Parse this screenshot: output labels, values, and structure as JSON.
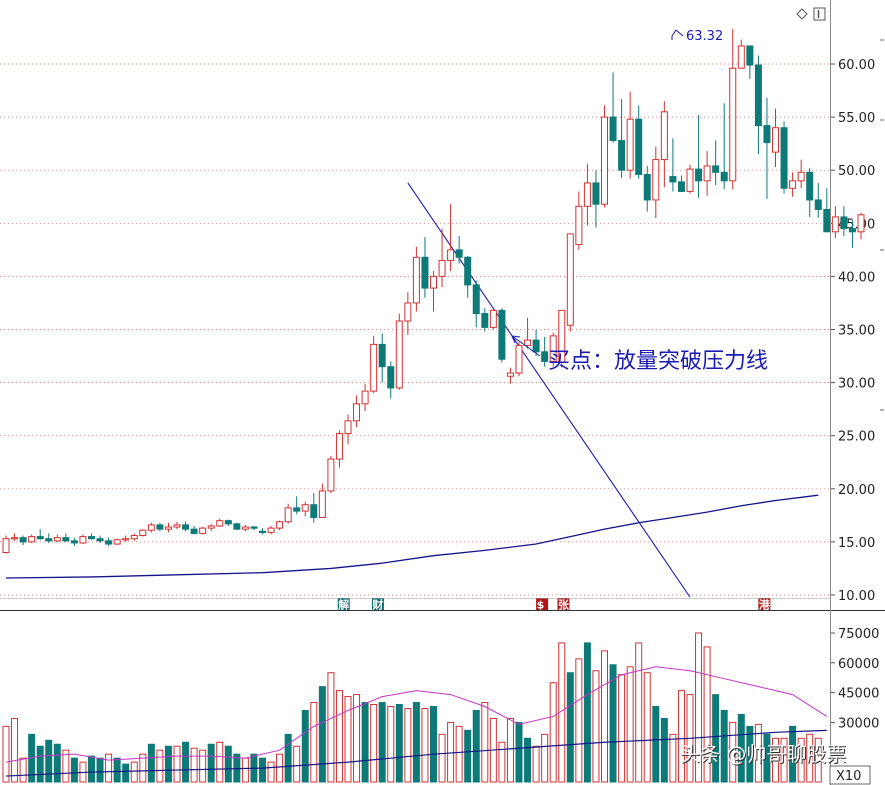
{
  "chart_data": [
    {
      "type": "candlestick",
      "title": "",
      "y_axis_side": "right",
      "ylim": [
        9,
        66
      ],
      "yticks": [
        "10.00",
        "15.00",
        "20.00",
        "25.00",
        "30.00",
        "35.00",
        "40.00",
        "45.00",
        "50.00",
        "55.00",
        "60.00"
      ],
      "grid": true,
      "colors": {
        "up": "#d23232",
        "down": "#0d7a78",
        "ma": "#14148c",
        "trendline": "#1a1ab4",
        "grid": "#c86464"
      },
      "peak_label": "63.32",
      "peak_value": 63.32,
      "annotation": {
        "text": "买点：放量突破压力线",
        "pointer_target_index": 61
      },
      "trendline": {
        "from_index": 47,
        "from_price": 48.8,
        "to_index": 80,
        "to_price": 9.8
      },
      "ma_line": [
        [
          0,
          11.6
        ],
        [
          10,
          11.7
        ],
        [
          20,
          11.9
        ],
        [
          30,
          12.1
        ],
        [
          38,
          12.5
        ],
        [
          44,
          13.0
        ],
        [
          50,
          13.7
        ],
        [
          56,
          14.2
        ],
        [
          62,
          14.8
        ],
        [
          66,
          15.5
        ],
        [
          70,
          16.2
        ],
        [
          74,
          16.8
        ],
        [
          78,
          17.3
        ],
        [
          82,
          17.8
        ],
        [
          86,
          18.4
        ],
        [
          90,
          18.9
        ],
        [
          95,
          19.4
        ]
      ],
      "event_badges": [
        {
          "index": 39.5,
          "label": "解",
          "color": "#0d6e6e"
        },
        {
          "index": 43.5,
          "label": "财",
          "color": "#0d6e6e"
        },
        {
          "index": 62.7,
          "label": "$",
          "color": "#b01818"
        },
        {
          "index": 65.2,
          "label": "张",
          "color": "#b01818"
        },
        {
          "index": 88.7,
          "label": "港",
          "color": "#b01818"
        }
      ],
      "candles": [
        [
          14.0,
          15.6,
          13.9,
          15.3
        ],
        [
          15.3,
          15.8,
          15.1,
          15.4
        ],
        [
          15.4,
          15.6,
          14.7,
          15.0
        ],
        [
          15.0,
          15.7,
          14.9,
          15.5
        ],
        [
          15.5,
          16.2,
          15.2,
          15.3
        ],
        [
          15.3,
          15.8,
          14.9,
          15.1
        ],
        [
          15.1,
          15.7,
          15.0,
          15.4
        ],
        [
          15.4,
          15.8,
          15.0,
          15.1
        ],
        [
          15.1,
          15.4,
          14.6,
          14.9
        ],
        [
          14.9,
          15.7,
          14.8,
          15.5
        ],
        [
          15.5,
          15.8,
          15.2,
          15.3
        ],
        [
          15.3,
          15.6,
          14.9,
          15.1
        ],
        [
          15.1,
          15.4,
          14.6,
          14.8
        ],
        [
          14.8,
          15.3,
          14.7,
          15.2
        ],
        [
          15.2,
          15.6,
          15.0,
          15.3
        ],
        [
          15.3,
          15.8,
          15.1,
          15.6
        ],
        [
          15.6,
          16.2,
          15.5,
          16.1
        ],
        [
          16.1,
          16.8,
          15.9,
          16.6
        ],
        [
          16.6,
          16.8,
          16.0,
          16.2
        ],
        [
          16.2,
          16.8,
          15.9,
          16.4
        ],
        [
          16.4,
          16.9,
          16.2,
          16.6
        ],
        [
          16.6,
          16.9,
          16.0,
          16.2
        ],
        [
          16.2,
          16.5,
          15.7,
          15.8
        ],
        [
          15.8,
          16.4,
          15.7,
          16.3
        ],
        [
          16.3,
          16.7,
          16.0,
          16.5
        ],
        [
          16.5,
          17.2,
          16.4,
          17.0
        ],
        [
          17.0,
          17.1,
          16.5,
          16.7
        ],
        [
          16.7,
          16.8,
          16.1,
          16.2
        ],
        [
          16.2,
          16.6,
          16.0,
          16.4
        ],
        [
          16.4,
          16.5,
          16.1,
          16.3
        ],
        [
          16.0,
          16.3,
          15.7,
          15.9
        ],
        [
          15.9,
          16.5,
          15.7,
          16.3
        ],
        [
          16.3,
          17.0,
          16.1,
          16.9
        ],
        [
          16.9,
          18.6,
          16.7,
          18.2
        ],
        [
          18.2,
          19.3,
          17.6,
          17.9
        ],
        [
          17.9,
          18.8,
          17.4,
          18.5
        ],
        [
          18.5,
          19.6,
          16.8,
          17.3
        ],
        [
          17.3,
          20.5,
          17.3,
          19.8
        ],
        [
          19.8,
          23.1,
          19.6,
          22.8
        ],
        [
          22.8,
          25.5,
          22.0,
          25.2
        ],
        [
          25.2,
          27.0,
          24.2,
          26.4
        ],
        [
          26.4,
          28.8,
          25.8,
          28.0
        ],
        [
          28.0,
          29.9,
          27.3,
          29.2
        ],
        [
          29.2,
          34.4,
          29.0,
          33.6
        ],
        [
          33.6,
          34.6,
          30.0,
          31.5
        ],
        [
          31.5,
          32.0,
          28.5,
          29.5
        ],
        [
          29.5,
          36.5,
          29.3,
          35.8
        ],
        [
          35.8,
          38.5,
          34.5,
          37.5
        ],
        [
          37.5,
          42.8,
          36.7,
          41.8
        ],
        [
          41.8,
          43.7,
          38.0,
          38.9
        ],
        [
          38.9,
          40.5,
          36.7,
          40.0
        ],
        [
          40.0,
          44.5,
          39.0,
          41.5
        ],
        [
          41.5,
          46.8,
          40.5,
          42.5
        ],
        [
          42.5,
          43.8,
          41.2,
          41.8
        ],
        [
          41.8,
          41.9,
          38.0,
          39.2
        ],
        [
          39.2,
          39.6,
          35.2,
          36.5
        ],
        [
          36.5,
          37.0,
          34.8,
          35.2
        ],
        [
          35.2,
          37.1,
          35.0,
          36.8
        ],
        [
          36.8,
          37.0,
          31.9,
          32.2
        ],
        [
          30.6,
          31.4,
          29.9,
          30.9
        ],
        [
          30.9,
          33.8,
          30.6,
          33.5
        ],
        [
          33.5,
          36.1,
          33.2,
          34.0
        ],
        [
          34.0,
          35.0,
          32.5,
          32.9
        ],
        [
          32.9,
          34.3,
          31.5,
          32.0
        ],
        [
          32.0,
          34.7,
          31.5,
          34.4
        ],
        [
          31.9,
          32.4,
          31.4,
          36.8
        ],
        [
          35.4,
          37.6,
          34.8,
          44.0
        ],
        [
          43.0,
          48.0,
          42.5,
          46.6
        ],
        [
          46.6,
          50.6,
          44.8,
          48.8
        ],
        [
          48.8,
          50.0,
          44.6,
          46.8
        ],
        [
          46.8,
          56.1,
          46.5,
          55.0
        ],
        [
          55.0,
          59.2,
          52.6,
          52.8
        ],
        [
          52.8,
          56.7,
          49.3,
          50.0
        ],
        [
          50.0,
          57.4,
          49.2,
          54.8
        ],
        [
          54.8,
          56.1,
          49.2,
          49.6
        ],
        [
          49.6,
          50.4,
          46.1,
          47.2
        ],
        [
          47.2,
          52.2,
          45.5,
          51.0
        ],
        [
          51.0,
          56.5,
          48.4,
          55.5
        ],
        [
          49.4,
          53.0,
          48.0,
          48.9
        ],
        [
          48.9,
          49.5,
          48.0,
          48.0
        ],
        [
          48.0,
          50.5,
          47.8,
          50.1
        ],
        [
          50.1,
          55.2,
          47.4,
          49.0
        ],
        [
          49.0,
          51.8,
          47.6,
          50.4
        ],
        [
          50.4,
          52.8,
          48.6,
          49.8
        ],
        [
          49.8,
          56.3,
          48.2,
          49.0
        ],
        [
          49.0,
          63.32,
          48.2,
          59.6
        ],
        [
          59.6,
          62.3,
          59.6,
          61.7
        ],
        [
          61.7,
          60.8,
          58.6,
          59.9
        ],
        [
          59.9,
          60.8,
          51.5,
          54.2
        ],
        [
          54.2,
          56.8,
          47.3,
          52.6
        ],
        [
          51.7,
          55.8,
          50.3,
          54.0
        ],
        [
          54.0,
          54.6,
          47.8,
          48.3
        ],
        [
          48.3,
          49.8,
          47.5,
          49.0
        ],
        [
          49.0,
          51.0,
          48.3,
          49.8
        ],
        [
          49.8,
          50.2,
          45.6,
          47.2
        ],
        [
          47.2,
          48.8,
          45.5,
          46.3
        ],
        [
          46.3,
          48.3,
          44.7,
          44.2
        ],
        [
          44.2,
          46.6,
          43.6,
          45.6
        ],
        [
          45.6,
          46.6,
          43.8,
          44.5
        ],
        [
          44.5,
          45.3,
          42.7,
          44.2
        ],
        [
          44.2,
          46.0,
          43.5,
          45.8
        ]
      ]
    },
    {
      "type": "volume-bar",
      "ylim": [
        0,
        84000
      ],
      "yticks": [
        "30000",
        "45000",
        "60000",
        "75000"
      ],
      "unit_label": "X10",
      "ma_short": [
        [
          0,
          10
        ],
        [
          4,
          13
        ],
        [
          8,
          14
        ],
        [
          12,
          11
        ],
        [
          16,
          12
        ],
        [
          20,
          13
        ],
        [
          24,
          13
        ],
        [
          28,
          12
        ],
        [
          32,
          16
        ],
        [
          36,
          28
        ],
        [
          40,
          36
        ],
        [
          44,
          43
        ],
        [
          48,
          46
        ],
        [
          52,
          44
        ],
        [
          56,
          38
        ],
        [
          60,
          29
        ],
        [
          64,
          33
        ],
        [
          68,
          44
        ],
        [
          72,
          54
        ],
        [
          76,
          58
        ],
        [
          80,
          56
        ],
        [
          84,
          52
        ],
        [
          88,
          48
        ],
        [
          92,
          44
        ],
        [
          96,
          33
        ]
      ],
      "ma_long": [
        [
          0,
          3
        ],
        [
          10,
          5
        ],
        [
          20,
          6
        ],
        [
          30,
          7
        ],
        [
          40,
          10
        ],
        [
          50,
          14
        ],
        [
          60,
          17
        ],
        [
          70,
          20
        ],
        [
          80,
          22
        ],
        [
          90,
          25
        ],
        [
          96,
          26
        ]
      ],
      "bars": [
        [
          28,
          1
        ],
        [
          32,
          1
        ],
        [
          12,
          1
        ],
        [
          24,
          0
        ],
        [
          18,
          0
        ],
        [
          21,
          0
        ],
        [
          19,
          0
        ],
        [
          16,
          1
        ],
        [
          12,
          0
        ],
        [
          10,
          1
        ],
        [
          13,
          0
        ],
        [
          12,
          0
        ],
        [
          14,
          1
        ],
        [
          12,
          0
        ],
        [
          9,
          0
        ],
        [
          10,
          1
        ],
        [
          14,
          1
        ],
        [
          19,
          0
        ],
        [
          16,
          1
        ],
        [
          18,
          0
        ],
        [
          18,
          1
        ],
        [
          20,
          0
        ],
        [
          17,
          1
        ],
        [
          16,
          1
        ],
        [
          19,
          0
        ],
        [
          20,
          1
        ],
        [
          18,
          0
        ],
        [
          14,
          0
        ],
        [
          12,
          1
        ],
        [
          14,
          0
        ],
        [
          12,
          0
        ],
        [
          10,
          1
        ],
        [
          14,
          1
        ],
        [
          24,
          0
        ],
        [
          18,
          1
        ],
        [
          36,
          0
        ],
        [
          40,
          1
        ],
        [
          48,
          0
        ],
        [
          55,
          1
        ],
        [
          46,
          1
        ],
        [
          43,
          1
        ],
        [
          44,
          1
        ],
        [
          40,
          0
        ],
        [
          39,
          1
        ],
        [
          40,
          0
        ],
        [
          38,
          1
        ],
        [
          39,
          0
        ],
        [
          37,
          1
        ],
        [
          40,
          0
        ],
        [
          37,
          1
        ],
        [
          38,
          0
        ],
        [
          24,
          1
        ],
        [
          30,
          1
        ],
        [
          28,
          1
        ],
        [
          26,
          0
        ],
        [
          36,
          0
        ],
        [
          40,
          1
        ],
        [
          32,
          1
        ],
        [
          20,
          1
        ],
        [
          32,
          1
        ],
        [
          30,
          0
        ],
        [
          22,
          0
        ],
        [
          18,
          1
        ],
        [
          24,
          1
        ],
        [
          50,
          1
        ],
        [
          70,
          1
        ],
        [
          55,
          0
        ],
        [
          62,
          1
        ],
        [
          70,
          0
        ],
        [
          56,
          1
        ],
        [
          66,
          1
        ],
        [
          59,
          0
        ],
        [
          54,
          1
        ],
        [
          58,
          1
        ],
        [
          70,
          1
        ],
        [
          55,
          1
        ],
        [
          38,
          0
        ],
        [
          32,
          0
        ],
        [
          24,
          1
        ],
        [
          46,
          1
        ],
        [
          44,
          1
        ],
        [
          75,
          1
        ],
        [
          68,
          1
        ],
        [
          44,
          0
        ],
        [
          36,
          0
        ],
        [
          30,
          1
        ],
        [
          34,
          0
        ],
        [
          28,
          0
        ],
        [
          29,
          1
        ],
        [
          24,
          0
        ],
        [
          22,
          1
        ],
        [
          22,
          1
        ],
        [
          28,
          0
        ],
        [
          22,
          1
        ],
        [
          24,
          1
        ],
        [
          22,
          1
        ]
      ]
    }
  ],
  "watermark": "头条 @帅哥聊股票"
}
